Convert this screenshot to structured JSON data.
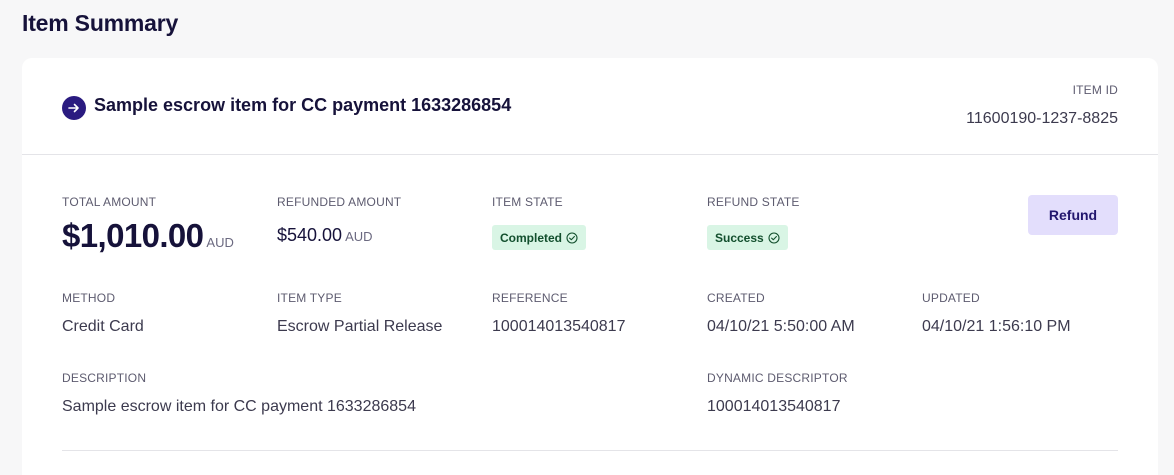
{
  "page": {
    "title": "Item Summary"
  },
  "item": {
    "title": "Sample escrow item for CC payment 1633286854",
    "id_label": "ITEM ID",
    "id_value": "11600190-1237-8825"
  },
  "amounts": {
    "total_label": "TOTAL AMOUNT",
    "total_value": "$1,010.00",
    "total_currency": "AUD",
    "refunded_label": "REFUNDED AMOUNT",
    "refunded_value": "$540.00",
    "refunded_currency": "AUD"
  },
  "states": {
    "item_state_label": "ITEM STATE",
    "item_state_value": "Completed",
    "refund_state_label": "REFUND STATE",
    "refund_state_value": "Success",
    "badge_color": "#d9f5e5"
  },
  "actions": {
    "refund_label": "Refund"
  },
  "details": {
    "method_label": "METHOD",
    "method_value": "Credit Card",
    "item_type_label": "ITEM TYPE",
    "item_type_value": "Escrow Partial Release",
    "reference_label": "REFERENCE",
    "reference_value": "100014013540817",
    "created_label": "CREATED",
    "created_value": "04/10/21 5:50:00 AM",
    "updated_label": "UPDATED",
    "updated_value": "04/10/21 1:56:10 PM",
    "description_label": "DESCRIPTION",
    "description_value": "Sample escrow item for CC payment 1633286854",
    "dynamic_descriptor_label": "DYNAMIC DESCRIPTOR",
    "dynamic_descriptor_value": "100014013540817"
  },
  "icons": {
    "item_icon": "arrow-right-circle-icon",
    "badge_icon": "check-circle-icon"
  },
  "colors": {
    "accent": "#2a1b80",
    "button_bg": "#e3defc",
    "text_primary": "#16123a"
  }
}
